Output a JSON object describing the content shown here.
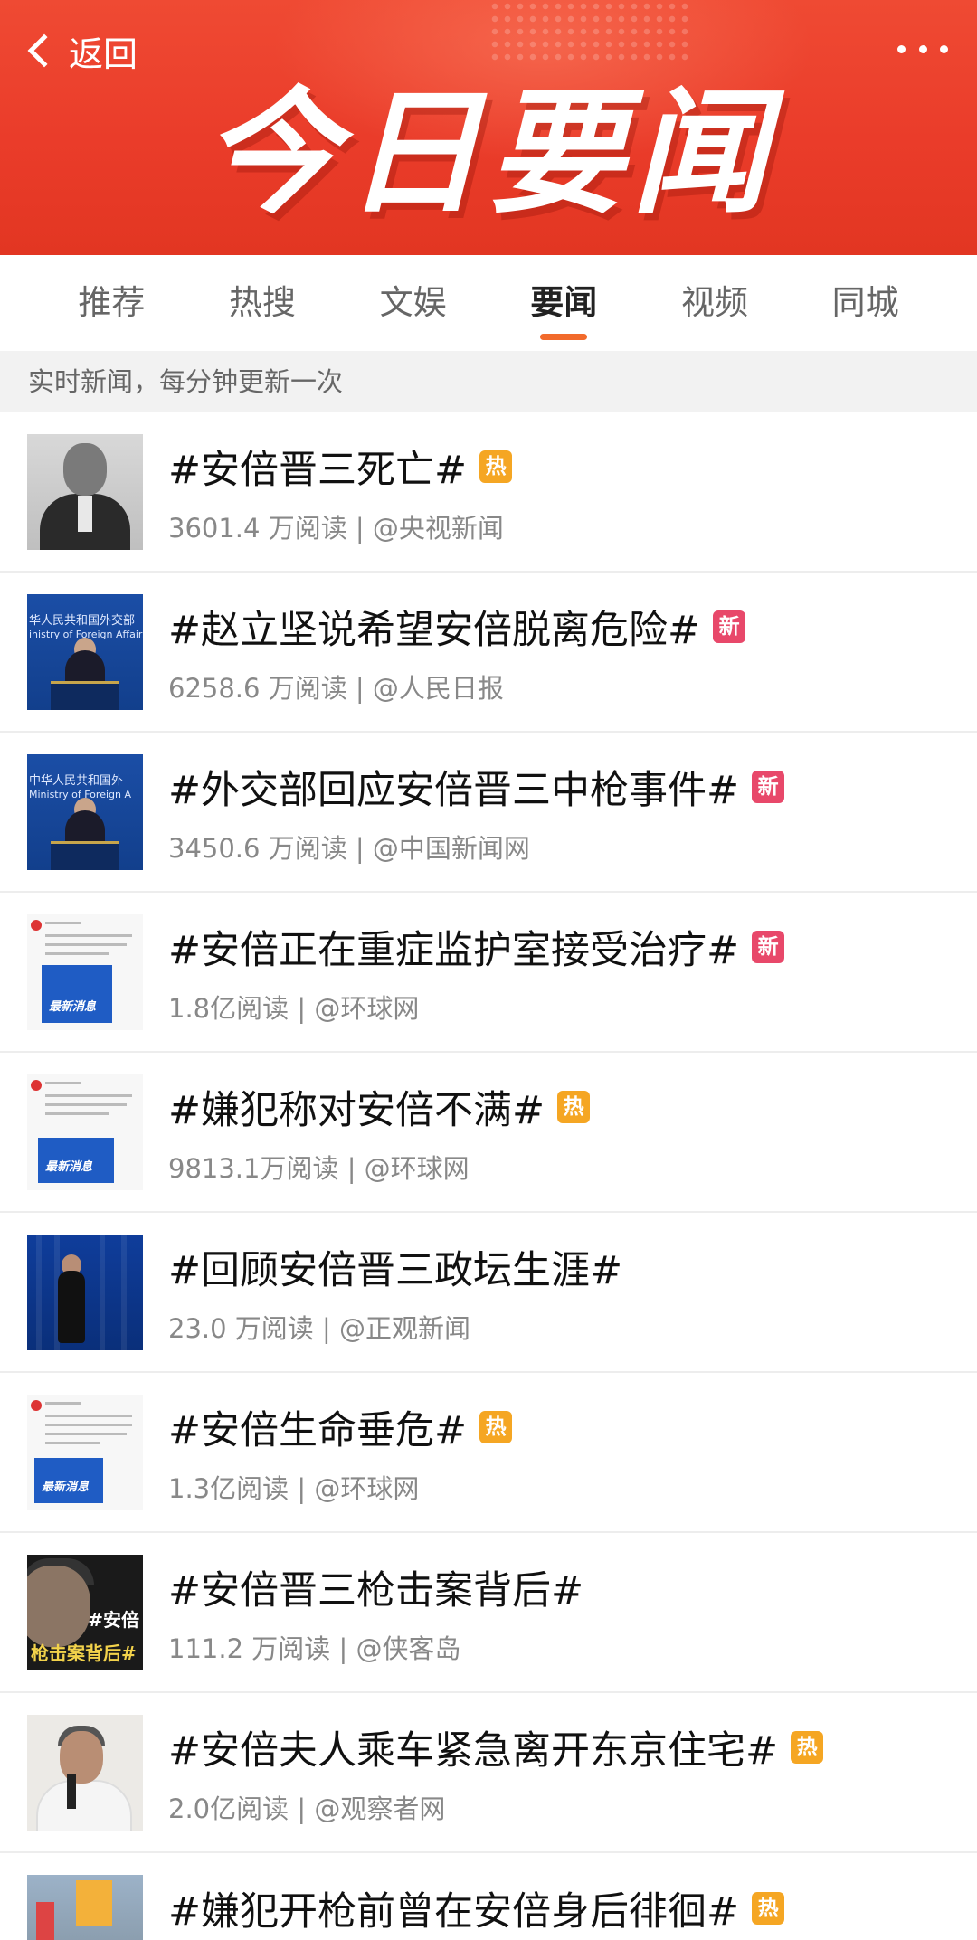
{
  "header": {
    "back_label": "返回",
    "banner_title": "今日要闻"
  },
  "tabs": [
    {
      "label": "推荐",
      "active": false
    },
    {
      "label": "热搜",
      "active": false
    },
    {
      "label": "文娱",
      "active": false
    },
    {
      "label": "要闻",
      "active": true
    },
    {
      "label": "视频",
      "active": false
    },
    {
      "label": "同城",
      "active": false
    }
  ],
  "notice": "实时新闻，每分钟更新一次",
  "colors": {
    "banner": "#ea3c2a",
    "badge_hot": "#f5a623",
    "badge_new": "#e8486a",
    "tab_indicator": "#f26a2b"
  },
  "items": [
    {
      "title": "#安倍晋三死亡#",
      "badge": "热",
      "badge_type": "hot",
      "meta": "3601.4 万阅读 | @央视新闻",
      "thumb": "portrait-thumbnail"
    },
    {
      "title": "#赵立坚说希望安倍脱离危险#",
      "badge": "新",
      "badge_type": "new",
      "meta": "6258.6 万阅读 | @人民日报",
      "thumb": "press-briefing-thumbnail",
      "thumb_text": "华人民共和国外交部",
      "thumb_text2": "inistry of Foreign Affairs"
    },
    {
      "title": "#外交部回应安倍晋三中枪事件#",
      "badge": "新",
      "badge_type": "new",
      "meta": "3450.6 万阅读 | @中国新闻网",
      "thumb": "press-briefing-thumbnail",
      "thumb_text": "中华人民共和国外",
      "thumb_text2": "Ministry of Foreign A"
    },
    {
      "title": "#安倍正在重症监护室接受治疗#",
      "badge": "新",
      "badge_type": "new",
      "meta": "1.8亿阅读 | @环球网",
      "thumb": "post-screenshot-thumbnail",
      "thumb_text": "最新消息"
    },
    {
      "title": "#嫌犯称对安倍不满#",
      "badge": "热",
      "badge_type": "hot",
      "meta": "9813.1万阅读 | @环球网",
      "thumb": "post-screenshot-thumbnail",
      "thumb_text": "最新消息"
    },
    {
      "title": "#回顾安倍晋三政坛生涯#",
      "badge": "",
      "badge_type": "none",
      "meta": "23.0 万阅读 | @正观新闻",
      "thumb": "walking-thumbnail"
    },
    {
      "title": "#安倍生命垂危#",
      "badge": "热",
      "badge_type": "hot",
      "meta": "1.3亿阅读 | @环球网",
      "thumb": "post-screenshot-thumbnail",
      "thumb_text": "最新消息"
    },
    {
      "title": "#安倍晋三枪击案背后#",
      "badge": "",
      "badge_type": "none",
      "meta": "111.2 万阅读 | @侠客岛",
      "thumb": "case-cover-thumbnail",
      "thumb_text": "#安倍",
      "thumb_text2": "枪击案背后#"
    },
    {
      "title": "#安倍夫人乘车紧急离开东京住宅#",
      "badge": "热",
      "badge_type": "hot",
      "meta": "2.0亿阅读 | @观察者网",
      "thumb": "speech-thumbnail"
    },
    {
      "title": "#嫌犯开枪前曾在安倍身后徘徊#",
      "badge": "热",
      "badge_type": "hot",
      "meta": "",
      "thumb": "street-thumbnail"
    }
  ]
}
